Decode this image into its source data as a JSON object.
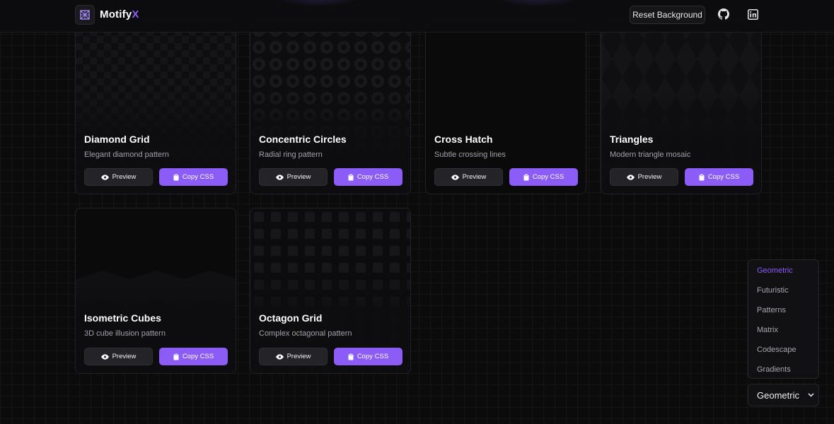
{
  "header": {
    "brand_main": "Motify",
    "brand_accent": "X",
    "reset_label": "Reset Background",
    "logo_icon": "grid-logo-icon",
    "icons": [
      "github-icon",
      "linkedin-icon"
    ]
  },
  "buttons": {
    "preview_label": "Preview",
    "copy_label": "Copy CSS"
  },
  "cards": [
    {
      "title": "Diamond Grid",
      "description": "Elegant diamond pattern"
    },
    {
      "title": "Concentric Circles",
      "description": "Radial ring pattern"
    },
    {
      "title": "Cross Hatch",
      "description": "Subtle crossing lines"
    },
    {
      "title": "Triangles",
      "description": "Modern triangle mosaic"
    },
    {
      "title": "Isometric Cubes",
      "description": "3D cube illusion pattern"
    },
    {
      "title": "Octagon Grid",
      "description": "Complex octagonal pattern"
    }
  ],
  "categories": {
    "items": [
      "Geometric",
      "Futuristic",
      "Patterns",
      "Matrix",
      "Codescape",
      "Gradients"
    ],
    "active": "Geometric",
    "selected": "Geometric"
  },
  "colors": {
    "accent": "#8b5cf6",
    "background": "#0b0b0c"
  }
}
